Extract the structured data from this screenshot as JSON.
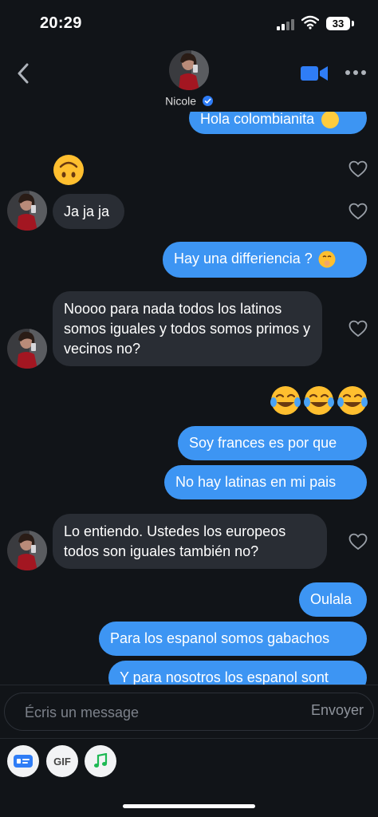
{
  "status_bar": {
    "time": "20:29",
    "battery": "33"
  },
  "header": {
    "contact_name": "Nicole"
  },
  "messages": {
    "m0": "Hola colombianita",
    "m1": "Ja ja ja",
    "m2": "Hay una differiencia ?",
    "m3": "Noooo para nada todos los latinos somos iguales y todos somos primos y vecinos no?",
    "m4": "Soy frances es por que",
    "m5": "No hay latinas en mi pais",
    "m6": "Lo entiendo. Ustedes los europeos todos son iguales también no?",
    "m7": "Oulala",
    "m8": "Para los espanol somos gabachos",
    "m9": "Y para nosotros los espanol sont"
  },
  "composer": {
    "placeholder": "Écris un message",
    "send_label": "Envoyer"
  },
  "toolbar": {
    "gif_label": "GIF"
  },
  "colors": {
    "background": "#111418",
    "sent_bubble": "#3d95f3",
    "received_bubble": "#292d34",
    "accent": "#2f7df6"
  },
  "icons": [
    "back-chevron-icon",
    "video-call-icon",
    "more-options-icon",
    "heart-icon",
    "verified-badge-icon",
    "card-icon",
    "gif-icon",
    "music-icon"
  ]
}
